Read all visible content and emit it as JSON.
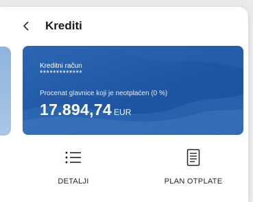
{
  "header": {
    "title": "Krediti"
  },
  "card": {
    "account_label": "Kreditni račun",
    "account_number_masked": "*************",
    "description": "Procenat glavnice koji je neotplaćen (0 %)",
    "amount": "17.894,74",
    "currency": "EUR"
  },
  "actions": [
    {
      "label": "DETALJI",
      "icon": "list-icon"
    },
    {
      "label": "PLAN OTPLATE",
      "icon": "document-icon"
    }
  ],
  "colors": {
    "card_blue": "#1f56a4",
    "background": "#e9eaec"
  }
}
